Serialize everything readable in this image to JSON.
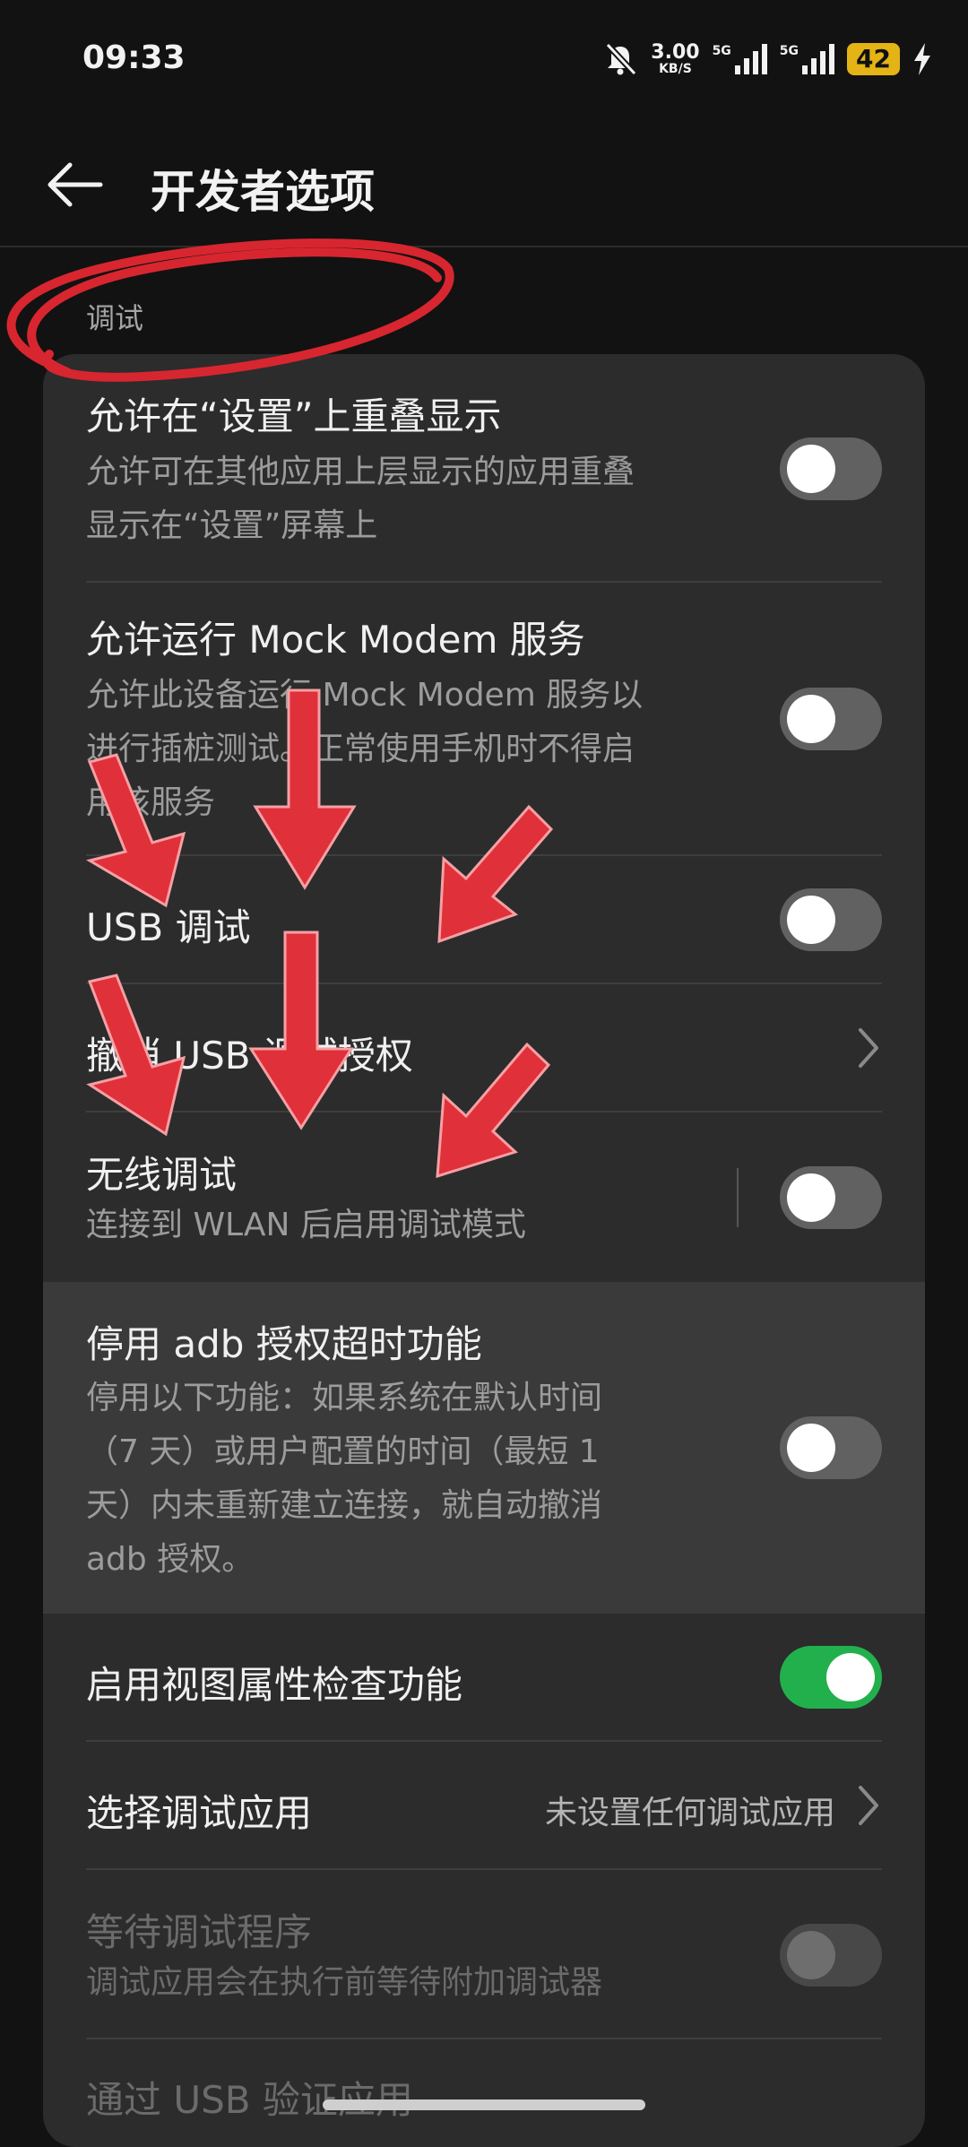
{
  "status_bar": {
    "time": "09:33",
    "speed_value": "3.00",
    "speed_unit": "KB/S",
    "network_1": "5G",
    "network_2": "5G",
    "battery": "42"
  },
  "header": {
    "title": "开发者选项"
  },
  "section_label": "调试",
  "rows": [
    {
      "title": "允许在“设置”上重叠显示",
      "subtitle_lines": [
        "允许可在其他应用上层显示的应用重叠",
        "显示在“设置”屏幕上"
      ],
      "toggle": "off"
    },
    {
      "title": "允许运行 Mock Modem 服务",
      "subtitle_lines": [
        "允许此设备运行 Mock Modem 服务以",
        "进行插桩测试。正常使用手机时不得启",
        "用该服务"
      ],
      "toggle": "off"
    },
    {
      "title": "USB 调试",
      "toggle": "off"
    },
    {
      "title": "撤消 USB 调试授权",
      "chevron": true
    },
    {
      "title": "无线调试",
      "subtitle_lines": [
        "连接到 WLAN 后启用调试模式"
      ],
      "toggle": "off"
    },
    {
      "title": "停用 adb 授权超时功能",
      "subtitle_lines": [
        "停用以下功能：如果系统在默认时间",
        "（7 天）或用户配置的时间（最短 1",
        "天）内未重新建立连接，就自动撤消",
        "adb 授权。"
      ],
      "toggle": "off",
      "highlighted": true
    },
    {
      "title": "启用视图属性检查功能",
      "toggle": "on"
    },
    {
      "title": "选择调试应用",
      "value": "未设置任何调试应用",
      "chevron": true
    },
    {
      "title": "等待调试程序",
      "subtitle_lines": [
        "调试应用会在执行前等待附加调试器"
      ],
      "toggle": "disabled",
      "disabled": true
    },
    {
      "title": "通过 USB 验证应用"
    }
  ],
  "colors": {
    "accent_on": "#22b04d",
    "battery": "#e4b315",
    "annotation": "#e0303a"
  }
}
